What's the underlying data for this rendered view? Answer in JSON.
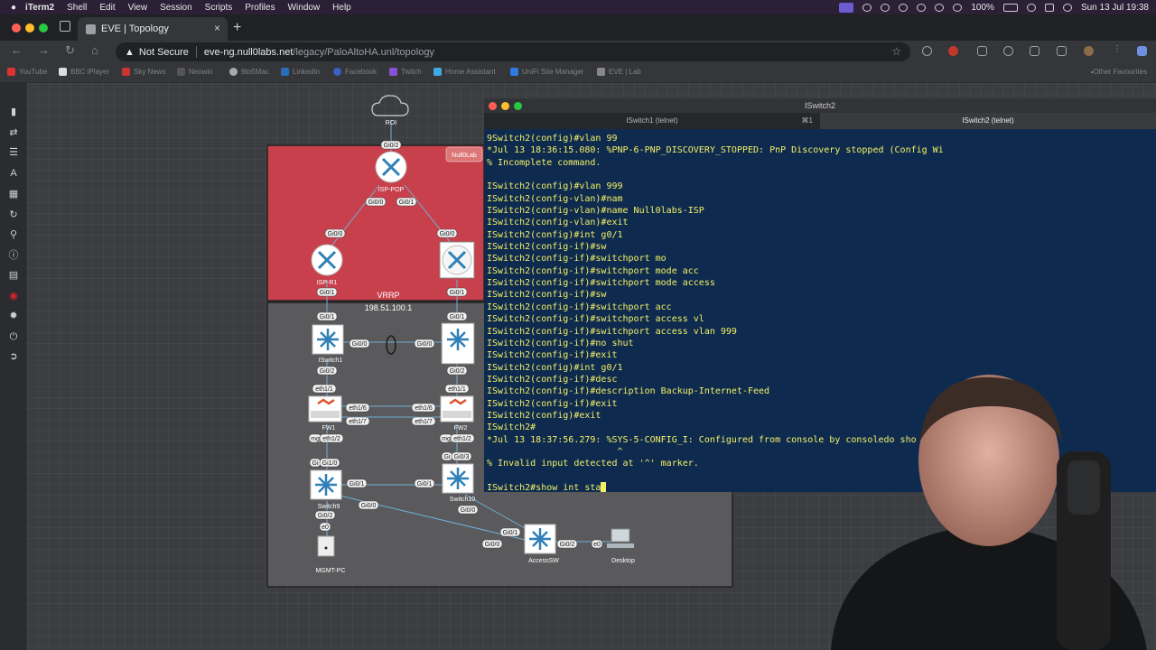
{
  "menubar": {
    "app": "iTerm2",
    "items": [
      "Shell",
      "Edit",
      "View",
      "Session",
      "Scripts",
      "Profiles",
      "Window",
      "Help"
    ],
    "battery": "100%",
    "datetime": "Sun 13 Jul  19:38"
  },
  "browser": {
    "tab_title": "EVE | Topology",
    "security_label": "Not Secure",
    "url_host": "eve-ng.null0labs.net",
    "url_path": "/legacy/PaloAltoHA.unl/topology",
    "bookmarks": [
      "YouTube",
      "BBC iPlayer",
      "Sky News",
      "Neowin",
      "9to5Mac",
      "LinkedIn",
      "Facebook",
      "Twitch",
      "Home Assistant",
      "UniFi Site Manager",
      "EVE | Lab"
    ],
    "other_favourites": "Other Favourites"
  },
  "topology": {
    "cloud": "ROI",
    "vrrp_label": "VRRP",
    "vrrp_ip": "198.51.100.1",
    "nodes": {
      "isp_pop": "ISP-POP",
      "isp_r1": "ISP-R1",
      "iswitch1": "ISwitch1",
      "fw1": "FW1",
      "fw2": "FW2",
      "switch9": "Switch9",
      "switch10": "Switch10",
      "access_sw": "AccessSW",
      "desktop": "Desktop",
      "mgmt_pc": "MGMT-PC"
    },
    "ports": {
      "gi02": "Gi0/2",
      "gi00": "Gi0/0",
      "gi01": "Gi0/1",
      "gi03": "Gi0/3",
      "eth11": "eth1/1",
      "eth12": "eth1/2",
      "eth16": "eth1/6",
      "eth17": "eth1/7",
      "mg": "mg",
      "gi10": "Gi1/0",
      "gi": "Gi",
      "e0": "e0",
      "null0": "Null0Lab"
    }
  },
  "terminal": {
    "window_title": "ISwitch2",
    "tab1": "ISwitch1 (telnet)",
    "tab1_shortcut": "⌘1",
    "tab2": "ISwitch2 (telnet)",
    "lines": [
      "9Switch2(config)#vlan 99",
      "*Jul 13 18:36:15.080: %PNP-6-PNP_DISCOVERY_STOPPED: PnP Discovery stopped (Config Wi",
      "% Incomplete command.",
      "",
      "ISwitch2(config)#vlan 999",
      "ISwitch2(config-vlan)#nam",
      "ISwitch2(config-vlan)#name Null0labs-ISP",
      "ISwitch2(config-vlan)#exit",
      "ISwitch2(config)#int g0/1",
      "ISwitch2(config-if)#sw",
      "ISwitch2(config-if)#switchport mo",
      "ISwitch2(config-if)#switchport mode acc",
      "ISwitch2(config-if)#switchport mode access",
      "ISwitch2(config-if)#sw",
      "ISwitch2(config-if)#switchport acc",
      "ISwitch2(config-if)#switchport access vl",
      "ISwitch2(config-if)#switchport access vlan 999",
      "ISwitch2(config-if)#no shut",
      "ISwitch2(config-if)#exit",
      "ISwitch2(config)#int g0/1",
      "ISwitch2(config-if)#desc",
      "ISwitch2(config-if)#description Backup-Internet-Feed",
      "ISwitch2(config-if)#exit",
      "ISwitch2(config)#exit",
      "ISwitch2#",
      "*Jul 13 18:37:56.279: %SYS-5-CONFIG_I: Configured from console by consoledo sho",
      "                        ^",
      "% Invalid input detected at '^' marker.",
      ""
    ],
    "current_input": "ISwitch2#show int sta"
  },
  "colors": {
    "terminal_bg": "#0e2b4f",
    "terminal_fg": "#f4f065",
    "isp_zone": "#c8404c",
    "lan_zone": "#5a5a5c"
  }
}
